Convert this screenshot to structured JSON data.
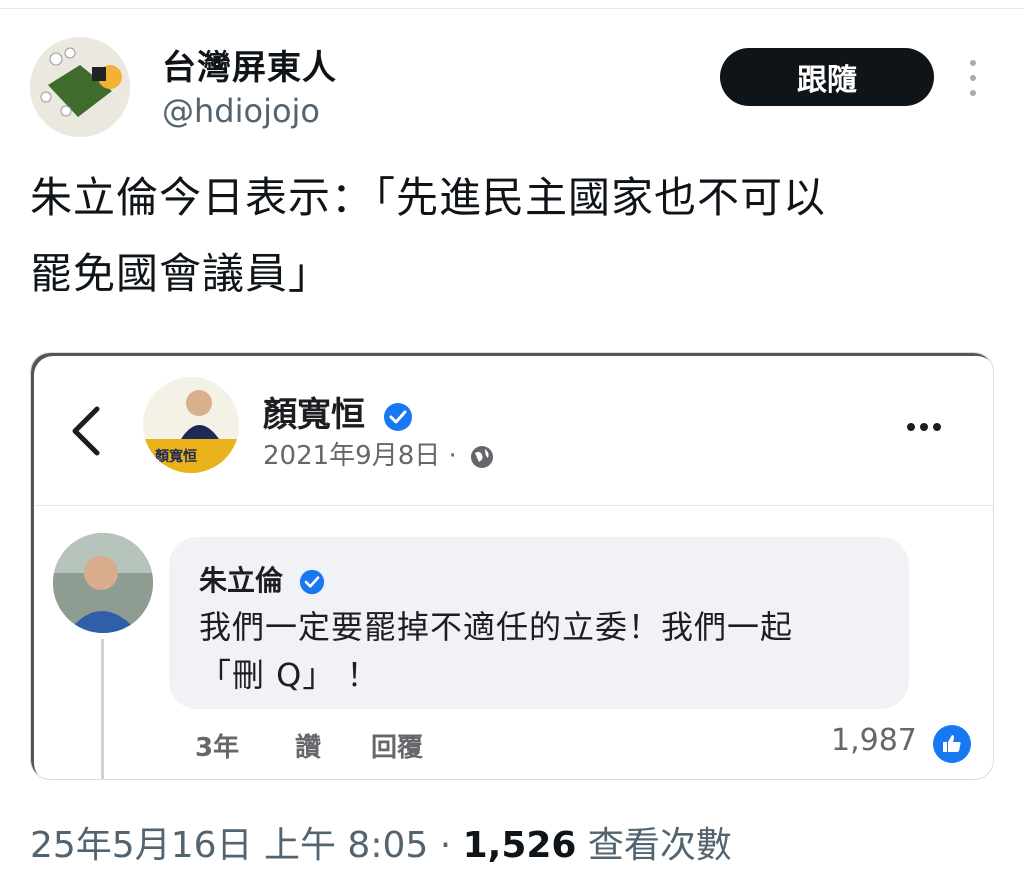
{
  "author": {
    "display_name": "台灣屏東人",
    "handle": "@hdiojojo"
  },
  "follow_label": "跟隨",
  "tweet": {
    "line1": "朱立倫今日表示：「先進民主國家也不可以",
    "line2": "罷免國會議員」"
  },
  "embed": {
    "page_name": "顏寬恒",
    "page_avatar_text": "顏寬恒",
    "post_date": "2021年9月8日 ·",
    "comment": {
      "name": "朱立倫",
      "text_line1": "我們一定要罷掉不適任的立委！我們一起",
      "text_line2": "「刪 Q」 ！",
      "time": "3年",
      "like_label": "讚",
      "reply_label": "回覆",
      "like_count": "1,987"
    },
    "verified_color": "#1877f2"
  },
  "footer": {
    "timestamp": "25年5月16日 上午 8:05 ·",
    "view_count": "1,526",
    "view_label": "查看次數"
  },
  "icons": {
    "more": "more-vertical-icon",
    "back": "chevron-left-icon",
    "verified": "verified-badge-icon",
    "globe": "globe-icon",
    "like": "thumbs-up-icon"
  }
}
